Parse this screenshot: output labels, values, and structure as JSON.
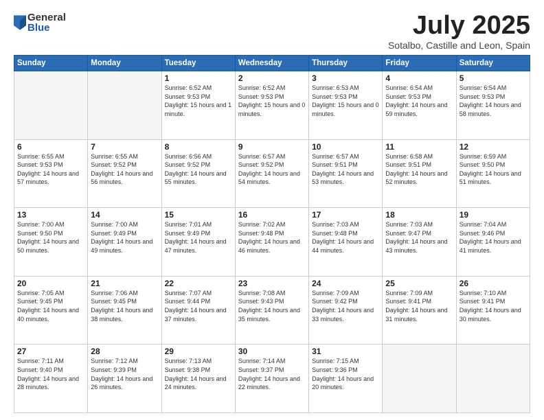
{
  "header": {
    "logo_general": "General",
    "logo_blue": "Blue",
    "month_title": "July 2025",
    "location": "Sotalbo, Castille and Leon, Spain"
  },
  "days_of_week": [
    "Sunday",
    "Monday",
    "Tuesday",
    "Wednesday",
    "Thursday",
    "Friday",
    "Saturday"
  ],
  "weeks": [
    [
      {
        "num": "",
        "sunrise": "",
        "sunset": "",
        "daylight": "",
        "empty": true
      },
      {
        "num": "",
        "sunrise": "",
        "sunset": "",
        "daylight": "",
        "empty": true
      },
      {
        "num": "1",
        "sunrise": "Sunrise: 6:52 AM",
        "sunset": "Sunset: 9:53 PM",
        "daylight": "Daylight: 15 hours and 1 minute.",
        "empty": false
      },
      {
        "num": "2",
        "sunrise": "Sunrise: 6:52 AM",
        "sunset": "Sunset: 9:53 PM",
        "daylight": "Daylight: 15 hours and 0 minutes.",
        "empty": false
      },
      {
        "num": "3",
        "sunrise": "Sunrise: 6:53 AM",
        "sunset": "Sunset: 9:53 PM",
        "daylight": "Daylight: 15 hours and 0 minutes.",
        "empty": false
      },
      {
        "num": "4",
        "sunrise": "Sunrise: 6:54 AM",
        "sunset": "Sunset: 9:53 PM",
        "daylight": "Daylight: 14 hours and 59 minutes.",
        "empty": false
      },
      {
        "num": "5",
        "sunrise": "Sunrise: 6:54 AM",
        "sunset": "Sunset: 9:53 PM",
        "daylight": "Daylight: 14 hours and 58 minutes.",
        "empty": false
      }
    ],
    [
      {
        "num": "6",
        "sunrise": "Sunrise: 6:55 AM",
        "sunset": "Sunset: 9:53 PM",
        "daylight": "Daylight: 14 hours and 57 minutes.",
        "empty": false
      },
      {
        "num": "7",
        "sunrise": "Sunrise: 6:55 AM",
        "sunset": "Sunset: 9:52 PM",
        "daylight": "Daylight: 14 hours and 56 minutes.",
        "empty": false
      },
      {
        "num": "8",
        "sunrise": "Sunrise: 6:56 AM",
        "sunset": "Sunset: 9:52 PM",
        "daylight": "Daylight: 14 hours and 55 minutes.",
        "empty": false
      },
      {
        "num": "9",
        "sunrise": "Sunrise: 6:57 AM",
        "sunset": "Sunset: 9:52 PM",
        "daylight": "Daylight: 14 hours and 54 minutes.",
        "empty": false
      },
      {
        "num": "10",
        "sunrise": "Sunrise: 6:57 AM",
        "sunset": "Sunset: 9:51 PM",
        "daylight": "Daylight: 14 hours and 53 minutes.",
        "empty": false
      },
      {
        "num": "11",
        "sunrise": "Sunrise: 6:58 AM",
        "sunset": "Sunset: 9:51 PM",
        "daylight": "Daylight: 14 hours and 52 minutes.",
        "empty": false
      },
      {
        "num": "12",
        "sunrise": "Sunrise: 6:59 AM",
        "sunset": "Sunset: 9:50 PM",
        "daylight": "Daylight: 14 hours and 51 minutes.",
        "empty": false
      }
    ],
    [
      {
        "num": "13",
        "sunrise": "Sunrise: 7:00 AM",
        "sunset": "Sunset: 9:50 PM",
        "daylight": "Daylight: 14 hours and 50 minutes.",
        "empty": false
      },
      {
        "num": "14",
        "sunrise": "Sunrise: 7:00 AM",
        "sunset": "Sunset: 9:49 PM",
        "daylight": "Daylight: 14 hours and 49 minutes.",
        "empty": false
      },
      {
        "num": "15",
        "sunrise": "Sunrise: 7:01 AM",
        "sunset": "Sunset: 9:49 PM",
        "daylight": "Daylight: 14 hours and 47 minutes.",
        "empty": false
      },
      {
        "num": "16",
        "sunrise": "Sunrise: 7:02 AM",
        "sunset": "Sunset: 9:48 PM",
        "daylight": "Daylight: 14 hours and 46 minutes.",
        "empty": false
      },
      {
        "num": "17",
        "sunrise": "Sunrise: 7:03 AM",
        "sunset": "Sunset: 9:48 PM",
        "daylight": "Daylight: 14 hours and 44 minutes.",
        "empty": false
      },
      {
        "num": "18",
        "sunrise": "Sunrise: 7:03 AM",
        "sunset": "Sunset: 9:47 PM",
        "daylight": "Daylight: 14 hours and 43 minutes.",
        "empty": false
      },
      {
        "num": "19",
        "sunrise": "Sunrise: 7:04 AM",
        "sunset": "Sunset: 9:46 PM",
        "daylight": "Daylight: 14 hours and 41 minutes.",
        "empty": false
      }
    ],
    [
      {
        "num": "20",
        "sunrise": "Sunrise: 7:05 AM",
        "sunset": "Sunset: 9:45 PM",
        "daylight": "Daylight: 14 hours and 40 minutes.",
        "empty": false
      },
      {
        "num": "21",
        "sunrise": "Sunrise: 7:06 AM",
        "sunset": "Sunset: 9:45 PM",
        "daylight": "Daylight: 14 hours and 38 minutes.",
        "empty": false
      },
      {
        "num": "22",
        "sunrise": "Sunrise: 7:07 AM",
        "sunset": "Sunset: 9:44 PM",
        "daylight": "Daylight: 14 hours and 37 minutes.",
        "empty": false
      },
      {
        "num": "23",
        "sunrise": "Sunrise: 7:08 AM",
        "sunset": "Sunset: 9:43 PM",
        "daylight": "Daylight: 14 hours and 35 minutes.",
        "empty": false
      },
      {
        "num": "24",
        "sunrise": "Sunrise: 7:09 AM",
        "sunset": "Sunset: 9:42 PM",
        "daylight": "Daylight: 14 hours and 33 minutes.",
        "empty": false
      },
      {
        "num": "25",
        "sunrise": "Sunrise: 7:09 AM",
        "sunset": "Sunset: 9:41 PM",
        "daylight": "Daylight: 14 hours and 31 minutes.",
        "empty": false
      },
      {
        "num": "26",
        "sunrise": "Sunrise: 7:10 AM",
        "sunset": "Sunset: 9:41 PM",
        "daylight": "Daylight: 14 hours and 30 minutes.",
        "empty": false
      }
    ],
    [
      {
        "num": "27",
        "sunrise": "Sunrise: 7:11 AM",
        "sunset": "Sunset: 9:40 PM",
        "daylight": "Daylight: 14 hours and 28 minutes.",
        "empty": false
      },
      {
        "num": "28",
        "sunrise": "Sunrise: 7:12 AM",
        "sunset": "Sunset: 9:39 PM",
        "daylight": "Daylight: 14 hours and 26 minutes.",
        "empty": false
      },
      {
        "num": "29",
        "sunrise": "Sunrise: 7:13 AM",
        "sunset": "Sunset: 9:38 PM",
        "daylight": "Daylight: 14 hours and 24 minutes.",
        "empty": false
      },
      {
        "num": "30",
        "sunrise": "Sunrise: 7:14 AM",
        "sunset": "Sunset: 9:37 PM",
        "daylight": "Daylight: 14 hours and 22 minutes.",
        "empty": false
      },
      {
        "num": "31",
        "sunrise": "Sunrise: 7:15 AM",
        "sunset": "Sunset: 9:36 PM",
        "daylight": "Daylight: 14 hours and 20 minutes.",
        "empty": false
      },
      {
        "num": "",
        "sunrise": "",
        "sunset": "",
        "daylight": "",
        "empty": true
      },
      {
        "num": "",
        "sunrise": "",
        "sunset": "",
        "daylight": "",
        "empty": true
      }
    ]
  ]
}
